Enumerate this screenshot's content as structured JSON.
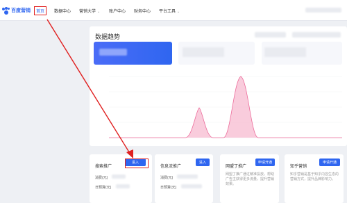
{
  "brand": {
    "name": "百度营销",
    "accent": "#2f66f0"
  },
  "nav": {
    "home": "首页",
    "data_center": "数据中心",
    "marketing": "营销大学",
    "account": "账户中心",
    "finance": "财务中心",
    "platform": "平台工具"
  },
  "trend": {
    "title": "数据趋势"
  },
  "cards": [
    {
      "title": "搜索推广",
      "button": "进入",
      "row1": "消费(元)",
      "row2": "日预算(元)"
    },
    {
      "title": "信息流推广",
      "button": "进入",
      "row1": "消费(元)",
      "row2": "日预算(元)"
    },
    {
      "title": "网盟丁推广",
      "button": "申请开通",
      "desc": "网盟丁推广通过精准投放，帮助广告主获得更多流量，提升营销效果。"
    },
    {
      "title": "知乎营销",
      "button": "申请开通",
      "desc": "知乎营销是基于知乎内容生态的营销方式，提升品牌影响力。"
    }
  ],
  "annotation_color": "#e02020"
}
